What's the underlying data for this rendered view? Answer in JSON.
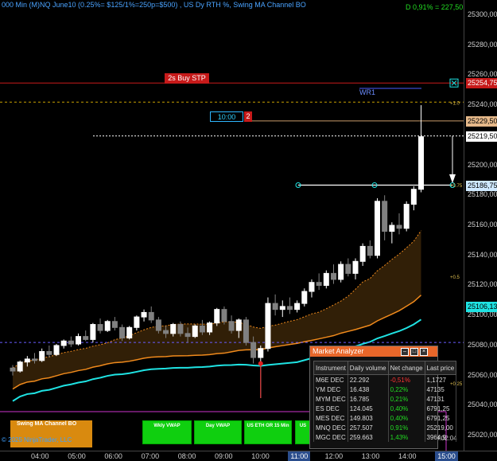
{
  "header": {
    "title": "000 Min (M)NQ June10 (0.25%= $125/1%=250p=$500) , US Dy RTH %, Swing MA Channel BO",
    "pnl": "D 0,91% = 227,50"
  },
  "price_axis": {
    "ticks": [
      "25300,00",
      "25280,00",
      "25260,00",
      "25240,00",
      "25220,00",
      "25200,00",
      "25180,00",
      "25160,00",
      "25140,00",
      "25120,00",
      "25100,00",
      "25080,00",
      "25060,00",
      "25040,00",
      "25020,00"
    ],
    "stop_label": "25254,75",
    "target_label": "25229,50",
    "last_label": "25219,50",
    "level_label": "25186,75",
    "ma_label": "25106,13",
    "fib_labels": [
      "+1.0",
      "+0.75",
      "+0.5",
      "+0.25"
    ]
  },
  "time_axis": {
    "ticks": [
      "04:00",
      "05:00",
      "06:00",
      "07:00",
      "08:00",
      "09:00",
      "10:00",
      "11:00",
      "12:00",
      "13:00",
      "14:00",
      "15:00"
    ]
  },
  "orders": {
    "stop_tag": "2s  Buy STP",
    "timer": "10:00",
    "timer_count": "2",
    "wr_label": "WR1"
  },
  "buttons": {
    "swing": "Swing MA Channel BO",
    "wkly_vwap": "Wkly VWAP",
    "day_vwap": "Day VWAP",
    "us_eth": "US ETH OR 15 Min",
    "us": "US"
  },
  "footer": {
    "copyright": "© 2025 NinjaTrader, LLC",
    "bar_timer": "0:02:04"
  },
  "market_analyzer": {
    "title": "Market Analyzer",
    "headers": [
      "Instrument",
      "Daily volume",
      "Net change",
      "Last price"
    ],
    "rows": [
      {
        "inst": "M6E DEC",
        "vol": "22.292",
        "net": "-0,51%",
        "last": "1,1727",
        "neg": true
      },
      {
        "inst": "YM DEC",
        "vol": "16.438",
        "net": "0,22%",
        "last": "47135",
        "neg": false
      },
      {
        "inst": "MYM DEC",
        "vol": "16.785",
        "net": "0,21%",
        "last": "47131",
        "neg": false
      },
      {
        "inst": "ES DEC",
        "vol": "124.045",
        "net": "0,40%",
        "last": "6791,25",
        "neg": false
      },
      {
        "inst": "MES DEC",
        "vol": "149.803",
        "net": "0,40%",
        "last": "6791,25",
        "neg": false
      },
      {
        "inst": "MNQ DEC",
        "vol": "257.507",
        "net": "0,91%",
        "last": "25219,00",
        "neg": false
      },
      {
        "inst": "MGC DEC",
        "vol": "259.663",
        "net": "1,43%",
        "last": "3964,9",
        "neg": false
      }
    ]
  },
  "colors": {
    "accent_orange": "#e8672a",
    "bull": "#ffffff",
    "bear": "#808080",
    "cyan_ma": "#1fe3e3",
    "orange_ma": "#f08a1c",
    "stop_red": "#c71a1a"
  },
  "candles": [
    {
      "o": 25065,
      "h": 25067,
      "l": 25060,
      "c": 25063
    },
    {
      "o": 25063,
      "h": 25070,
      "l": 25062,
      "c": 25069
    },
    {
      "o": 25069,
      "h": 25073,
      "l": 25066,
      "c": 25071
    },
    {
      "o": 25071,
      "h": 25075,
      "l": 25068,
      "c": 25070
    },
    {
      "o": 25070,
      "h": 25078,
      "l": 25069,
      "c": 25076
    },
    {
      "o": 25076,
      "h": 25080,
      "l": 25072,
      "c": 25074
    },
    {
      "o": 25074,
      "h": 25081,
      "l": 25073,
      "c": 25080
    },
    {
      "o": 25080,
      "h": 25084,
      "l": 25078,
      "c": 25083
    },
    {
      "o": 25083,
      "h": 25086,
      "l": 25079,
      "c": 25081
    },
    {
      "o": 25081,
      "h": 25088,
      "l": 25080,
      "c": 25086
    },
    {
      "o": 25086,
      "h": 25090,
      "l": 25083,
      "c": 25084
    },
    {
      "o": 25084,
      "h": 25095,
      "l": 25082,
      "c": 25094
    },
    {
      "o": 25094,
      "h": 25098,
      "l": 25088,
      "c": 25090
    },
    {
      "o": 25090,
      "h": 25097,
      "l": 25089,
      "c": 25096
    },
    {
      "o": 25096,
      "h": 25099,
      "l": 25090,
      "c": 25092
    },
    {
      "o": 25092,
      "h": 25094,
      "l": 25083,
      "c": 25085
    },
    {
      "o": 25085,
      "h": 25093,
      "l": 25084,
      "c": 25092
    },
    {
      "o": 25092,
      "h": 25100,
      "l": 25090,
      "c": 25099
    },
    {
      "o": 25099,
      "h": 25104,
      "l": 25096,
      "c": 25102
    },
    {
      "o": 25102,
      "h": 25106,
      "l": 25095,
      "c": 25097
    },
    {
      "o": 25097,
      "h": 25099,
      "l": 25088,
      "c": 25090
    },
    {
      "o": 25090,
      "h": 25093,
      "l": 25085,
      "c": 25088
    },
    {
      "o": 25088,
      "h": 25095,
      "l": 25086,
      "c": 25094
    },
    {
      "o": 25094,
      "h": 25096,
      "l": 25086,
      "c": 25088
    },
    {
      "o": 25088,
      "h": 25092,
      "l": 25082,
      "c": 25086
    },
    {
      "o": 25086,
      "h": 25094,
      "l": 25085,
      "c": 25093
    },
    {
      "o": 25093,
      "h": 25097,
      "l": 25087,
      "c": 25089
    },
    {
      "o": 25089,
      "h": 25096,
      "l": 25087,
      "c": 25095
    },
    {
      "o": 25095,
      "h": 25105,
      "l": 25093,
      "c": 25104
    },
    {
      "o": 25104,
      "h": 25106,
      "l": 25094,
      "c": 25096
    },
    {
      "o": 25096,
      "h": 25100,
      "l": 25088,
      "c": 25090
    },
    {
      "o": 25090,
      "h": 25098,
      "l": 25085,
      "c": 25097
    },
    {
      "o": 25097,
      "h": 25099,
      "l": 25080,
      "c": 25082
    },
    {
      "o": 25082,
      "h": 25086,
      "l": 25068,
      "c": 25072
    },
    {
      "o": 25072,
      "h": 25080,
      "l": 25045,
      "c": 25078
    },
    {
      "o": 25078,
      "h": 25112,
      "l": 25076,
      "c": 25108
    },
    {
      "o": 25108,
      "h": 25114,
      "l": 25100,
      "c": 25104
    },
    {
      "o": 25104,
      "h": 25110,
      "l": 25099,
      "c": 25106
    },
    {
      "o": 25106,
      "h": 25112,
      "l": 25101,
      "c": 25104
    },
    {
      "o": 25104,
      "h": 25110,
      "l": 25102,
      "c": 25108
    },
    {
      "o": 25108,
      "h": 25118,
      "l": 25106,
      "c": 25116
    },
    {
      "o": 25116,
      "h": 25124,
      "l": 25112,
      "c": 25122
    },
    {
      "o": 25122,
      "h": 25128,
      "l": 25117,
      "c": 25120
    },
    {
      "o": 25120,
      "h": 25130,
      "l": 25118,
      "c": 25128
    },
    {
      "o": 25128,
      "h": 25134,
      "l": 25121,
      "c": 25124
    },
    {
      "o": 25124,
      "h": 25136,
      "l": 25122,
      "c": 25134
    },
    {
      "o": 25134,
      "h": 25138,
      "l": 25126,
      "c": 25128
    },
    {
      "o": 25128,
      "h": 25138,
      "l": 25124,
      "c": 25136
    },
    {
      "o": 25136,
      "h": 25148,
      "l": 25133,
      "c": 25146
    },
    {
      "o": 25146,
      "h": 25150,
      "l": 25138,
      "c": 25140
    },
    {
      "o": 25140,
      "h": 25178,
      "l": 25138,
      "c": 25176
    },
    {
      "o": 25176,
      "h": 25180,
      "l": 25150,
      "c": 25156
    },
    {
      "o": 25156,
      "h": 25162,
      "l": 25148,
      "c": 25160
    },
    {
      "o": 25160,
      "h": 25168,
      "l": 25154,
      "c": 25158
    },
    {
      "o": 25158,
      "h": 25176,
      "l": 25156,
      "c": 25174
    },
    {
      "o": 25174,
      "h": 25186,
      "l": 25170,
      "c": 25184
    },
    {
      "o": 25184,
      "h": 25240,
      "l": 25182,
      "c": 25219
    }
  ]
}
